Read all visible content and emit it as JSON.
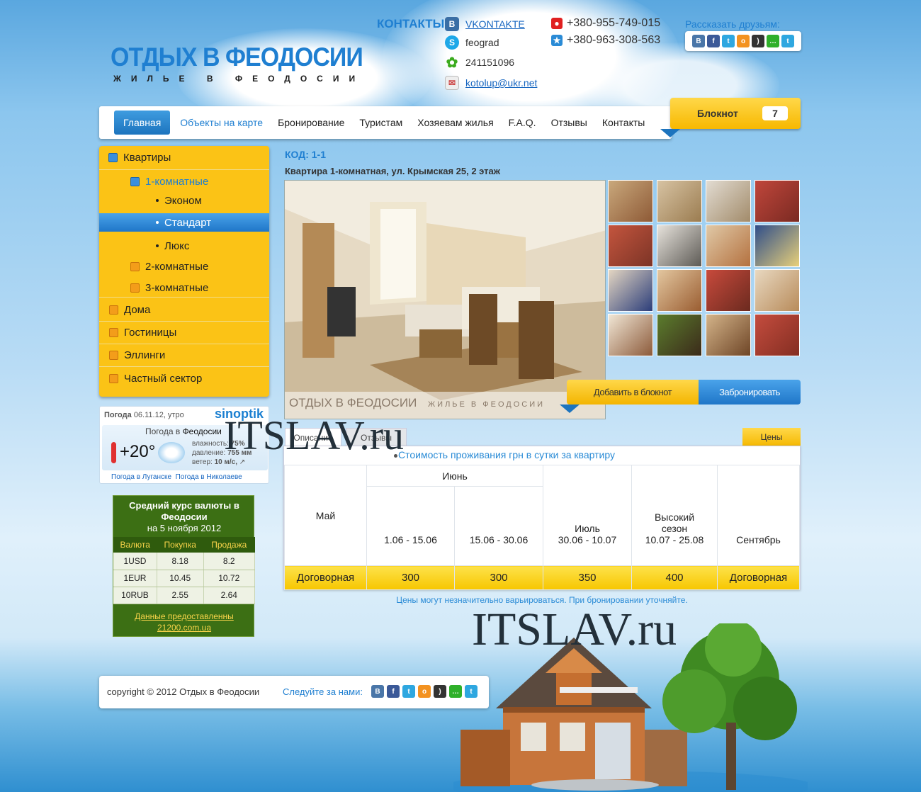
{
  "site": {
    "title": "ОТДЫХ В ФЕОДОСИИ",
    "subtitle": "ЖИЛЬЕ В ФЕОДОСИИ"
  },
  "contacts": {
    "label": "КОНТАКТЫ:",
    "items": [
      {
        "icon": "vkontakte-icon",
        "text": "VKONTAKTE",
        "link": true
      },
      {
        "icon": "skype-icon",
        "text": "feograd",
        "link": false
      },
      {
        "icon": "icq-icon",
        "text": "241151096",
        "link": false
      },
      {
        "icon": "email-icon",
        "text": "kotolup@ukr.net",
        "link": true
      }
    ],
    "phones": [
      "+380-955-749-015",
      "+380-963-308-563"
    ]
  },
  "share": {
    "label": "Рассказать друзьям:",
    "icons": [
      "vk-icon",
      "facebook-icon",
      "twitter-icon",
      "odnoklassniki-icon",
      "rss-icon",
      "chat-icon",
      "twitter-alt-icon"
    ]
  },
  "nav": {
    "items": [
      "Главная",
      "Объекты на карте",
      "Бронирование",
      "Туристам",
      "Хозяевам жилья",
      "F.A.Q.",
      "Отзывы",
      "Контакты"
    ]
  },
  "notebook": {
    "label": "Блокнот",
    "count": "7"
  },
  "sidebar": {
    "items": [
      {
        "label": "Квартиры"
      },
      {
        "label": "1-комнатные"
      },
      {
        "label": "Эконом"
      },
      {
        "label": "Стандарт"
      },
      {
        "label": "Люкс"
      },
      {
        "label": "2-комнатные"
      },
      {
        "label": "3-комнатные"
      },
      {
        "label": "Дома"
      },
      {
        "label": "Гостиницы"
      },
      {
        "label": "Эллинги"
      },
      {
        "label": "Частный сектор"
      }
    ]
  },
  "weather": {
    "title": "Погода",
    "date": "06.11.12, утро",
    "brand": "sinoptik",
    "city_prefix": "Погода в",
    "city": "Феодосии",
    "temp": "+20°",
    "humidity_label": "влажность:",
    "humidity": "75%",
    "pressure_label": "давление:",
    "pressure": "755 мм",
    "wind_label": "ветер:",
    "wind": "10 м/с,",
    "link1": "Погода в Луганске",
    "link2": "Погода в Николаеве"
  },
  "currency": {
    "title": "Средний курс валюты в Феодосии",
    "date": "на 5 ноября 2012",
    "headers": [
      "Валюта",
      "Покупка",
      "Продажа"
    ],
    "rows": [
      [
        "1USD",
        "8.18",
        "8.2"
      ],
      [
        "1EUR",
        "10.45",
        "10.72"
      ],
      [
        "10RUB",
        "2.55",
        "2.64"
      ]
    ],
    "source": "Данные предоставленны 21200.com.ua"
  },
  "listing": {
    "code": "КОД: 1-1",
    "title": "Квартира 1-комнатная, ул. Крымская 25, 2 этаж",
    "watermark": "ОТДЫХ В ФЕОДОСИИ",
    "watermark_sub": "ЖИЛЬЕ В ФЕОДОСИИ"
  },
  "actions": {
    "add": "Добавить в блокнот",
    "book": "Забронировать"
  },
  "tabs": {
    "desc": "Описание",
    "reviews": "Отзывы",
    "prices": "Цены"
  },
  "prices": {
    "title": "Стоимость проживания грн в сутки за квартиру",
    "may": "Май",
    "june": "Июнь",
    "june1": "1.06 - 15.06",
    "june2": "15.06 - 30.06",
    "july": "Июль",
    "july_range": "30.06 - 10.07",
    "high": "Высокий",
    "high2": "сезон",
    "high_range": "10.07 - 25.08",
    "sep": "Сентябрь",
    "values": [
      "Договорная",
      "300",
      "300",
      "350",
      "400",
      "Договорная"
    ],
    "note": "Цены могут незначительно  варьироваться. При бронировании уточняйте."
  },
  "footer": {
    "copyright": "copyright © 2012 Отдых в Феодосии",
    "follow": "Следуйте за нами:"
  },
  "watermark_text": "ITSLAV.ru"
}
